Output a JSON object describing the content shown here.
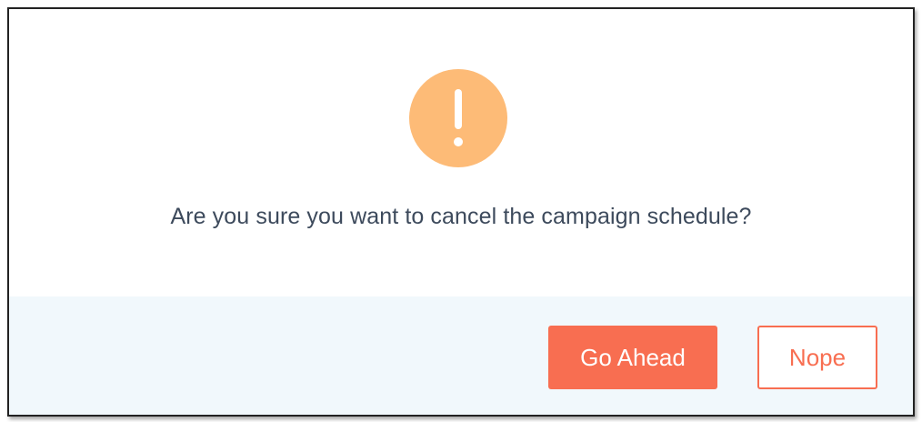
{
  "dialog": {
    "icon": "warning-exclamation-icon",
    "message": "Are you sure you want to cancel the campaign schedule?",
    "confirm_label": "Go Ahead",
    "cancel_label": "Nope"
  },
  "colors": {
    "icon_bg": "#fdbb77",
    "accent": "#f86e51",
    "footer_bg": "#f1f8fc",
    "text": "#3d4a5c"
  }
}
